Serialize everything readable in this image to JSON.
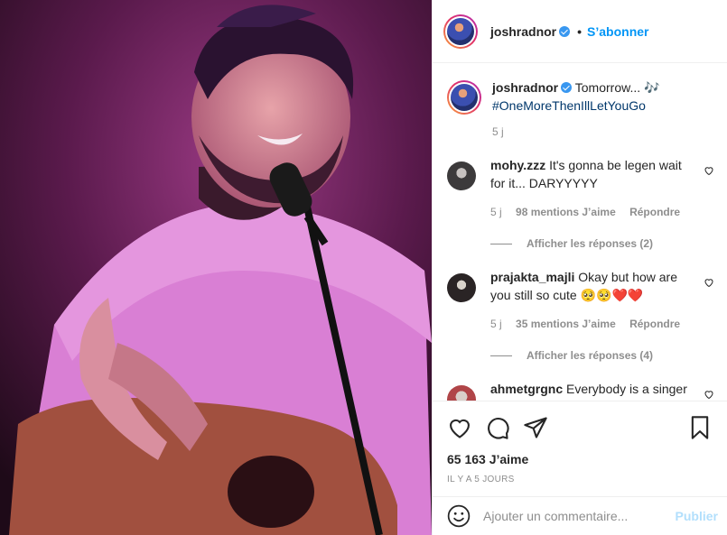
{
  "post": {
    "photo_icon": "concert-photo",
    "username": "joshradnor",
    "separator": "•",
    "follow_label": "S’abonner",
    "caption_text": "Tomorrow... 🎶",
    "caption_hashtag": "#OneMoreThenIllLetYouGo",
    "caption_time": "5 j"
  },
  "comments": [
    {
      "username": "mohy.zzz",
      "text": "It's gonna be legen wait for it... DARYYYYY",
      "time": "5 j",
      "likes": "98 mentions J’aime",
      "reply": "Répondre",
      "view_replies": "Afficher les réponses (2)"
    },
    {
      "username": "prajakta_majli",
      "text": "Okay but how are you still so cute 🥺🥺❤️❤️",
      "time": "5 j",
      "likes": "35 mentions J’aime",
      "reply": "Répondre",
      "view_replies": "Afficher les réponses (4)"
    },
    {
      "username": "ahmetgrgnc",
      "text": "Everybody is a singer"
    }
  ],
  "actions": {
    "likes_count": "65 163 J’aime",
    "posted_ago": "IL Y A 5 JOURS"
  },
  "add_comment": {
    "placeholder": "Ajouter un commentaire...",
    "publish_label": "Publier"
  },
  "colors": {
    "accent": "#0095f6",
    "text": "#262626",
    "muted": "#8e8e8e",
    "publish_disabled": "#b2dffc"
  }
}
